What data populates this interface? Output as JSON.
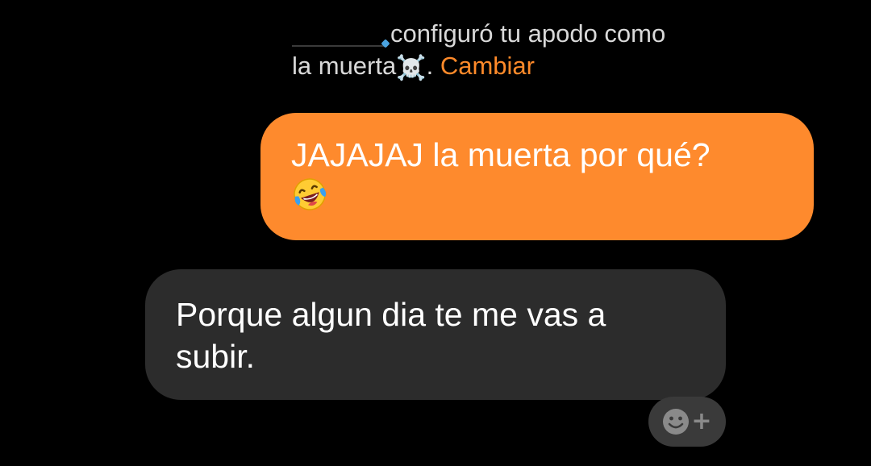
{
  "notice": {
    "text_line1": "configuró tu apodo como",
    "text_line2": "la muerta",
    "skull": "☠️",
    "period": ".",
    "change_label": "Cambiar"
  },
  "messages": [
    {
      "direction": "outgoing",
      "text": "JAJAJAJ la muerta por qué?",
      "emoji": "face-with-tears-of-joy-icon"
    },
    {
      "direction": "incoming",
      "text": "Porque algun dia te me vas a subir."
    }
  ],
  "reaction": {
    "plus": "+",
    "icon": "smiley-icon"
  },
  "colors": {
    "outgoing_bubble": "#fe8a2d",
    "incoming_bubble": "#2c2c2c",
    "accent_link": "#ff8a2a",
    "background": "#000000"
  }
}
